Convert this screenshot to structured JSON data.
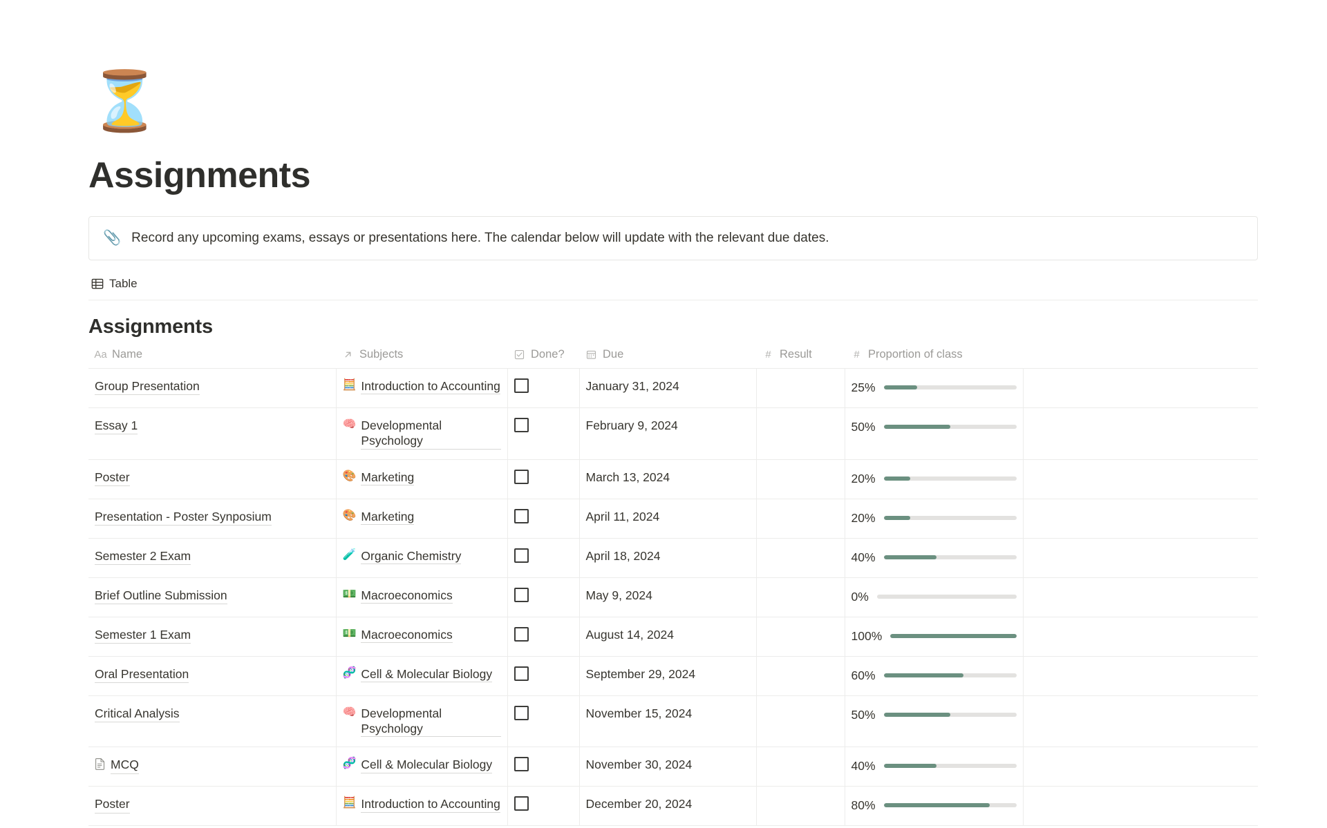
{
  "page": {
    "icon": "⏳",
    "icon_name": "hourglass-emoji",
    "title": "Assignments"
  },
  "callout": {
    "emoji": "📎",
    "emoji_name": "paperclip-emoji",
    "text": "Record any upcoming exams, essays or presentations here. The calendar below will update with the relevant due dates."
  },
  "views": {
    "tabs": [
      {
        "label": "Table",
        "icon": "table-icon",
        "active": true
      }
    ]
  },
  "database": {
    "title": "Assignments",
    "columns": [
      {
        "label": "Name",
        "icon": "text-aa-icon"
      },
      {
        "label": "Subjects",
        "icon": "relation-arrow-icon"
      },
      {
        "label": "Done?",
        "icon": "checkbox-icon"
      },
      {
        "label": "Due",
        "icon": "calendar-icon"
      },
      {
        "label": "Result",
        "icon": "number-hash-icon"
      },
      {
        "label": "Proportion of class",
        "icon": "number-hash-icon"
      }
    ],
    "rows": [
      {
        "name": "Group Presentation",
        "has_page_icon": false,
        "subject_emoji": "🧮",
        "subject": "Introduction to Accounting",
        "done": false,
        "due": "January 31, 2024",
        "result": "",
        "proportion_label": "25%",
        "proportion_value": 25
      },
      {
        "name": "Essay 1",
        "has_page_icon": false,
        "subject_emoji": "🧠",
        "subject": "Developmental Psychology",
        "done": false,
        "due": "February 9, 2024",
        "result": "",
        "proportion_label": "50%",
        "proportion_value": 50
      },
      {
        "name": "Poster",
        "has_page_icon": false,
        "subject_emoji": "🎨",
        "subject": "Marketing",
        "done": false,
        "due": "March 13, 2024",
        "result": "",
        "proportion_label": "20%",
        "proportion_value": 20
      },
      {
        "name": "Presentation - Poster Synposium",
        "has_page_icon": false,
        "subject_emoji": "🎨",
        "subject": "Marketing",
        "done": false,
        "due": "April 11, 2024",
        "result": "",
        "proportion_label": "20%",
        "proportion_value": 20
      },
      {
        "name": "Semester 2 Exam",
        "has_page_icon": false,
        "subject_emoji": "🧪",
        "subject": "Organic Chemistry",
        "done": false,
        "due": "April 18, 2024",
        "result": "",
        "proportion_label": "40%",
        "proportion_value": 40
      },
      {
        "name": "Brief Outline Submission",
        "has_page_icon": false,
        "subject_emoji": "💵",
        "subject": "Macroeconomics",
        "done": false,
        "due": "May 9, 2024",
        "result": "",
        "proportion_label": "0%",
        "proportion_value": 0
      },
      {
        "name": "Semester 1 Exam",
        "has_page_icon": false,
        "subject_emoji": "💵",
        "subject": "Macroeconomics",
        "done": false,
        "due": "August 14, 2024",
        "result": "",
        "proportion_label": "100%",
        "proportion_value": 100
      },
      {
        "name": "Oral Presentation",
        "has_page_icon": false,
        "subject_emoji": "🧬",
        "subject": "Cell & Molecular Biology",
        "done": false,
        "due": "September 29, 2024",
        "result": "",
        "proportion_label": "60%",
        "proportion_value": 60
      },
      {
        "name": "Critical Analysis",
        "has_page_icon": false,
        "subject_emoji": "🧠",
        "subject": "Developmental Psychology",
        "done": false,
        "due": "November 15, 2024",
        "result": "",
        "proportion_label": "50%",
        "proportion_value": 50
      },
      {
        "name": "MCQ",
        "has_page_icon": true,
        "subject_emoji": "🧬",
        "subject": "Cell & Molecular Biology",
        "done": false,
        "due": "November 30, 2024",
        "result": "",
        "proportion_label": "40%",
        "proportion_value": 40
      },
      {
        "name": "Poster",
        "has_page_icon": false,
        "subject_emoji": "🧮",
        "subject": "Introduction to Accounting",
        "done": false,
        "due": "December 20, 2024",
        "result": "",
        "proportion_label": "80%",
        "proportion_value": 80
      }
    ]
  },
  "colors": {
    "progress_fill": "#6b9080",
    "progress_track": "#e3e2e0",
    "text": "#37352f",
    "muted": "#9b9a97",
    "border": "#ececeb"
  }
}
